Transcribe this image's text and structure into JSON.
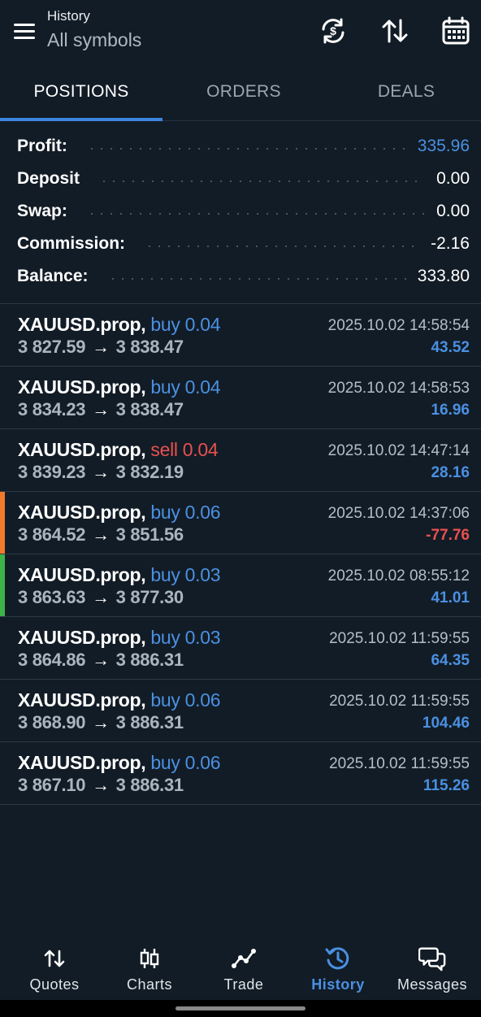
{
  "header": {
    "subtitle": "History",
    "title": "All symbols",
    "icons": [
      "menu-icon",
      "currency-exchange-icon",
      "sort-icon",
      "calendar-icon"
    ]
  },
  "tabs": [
    {
      "label": "POSITIONS",
      "active": true
    },
    {
      "label": "ORDERS",
      "active": false
    },
    {
      "label": "DEALS",
      "active": false
    }
  ],
  "summary": [
    {
      "label": "Profit:",
      "value": "335.96",
      "highlight": true
    },
    {
      "label": "Deposit",
      "value": "0.00",
      "highlight": false
    },
    {
      "label": "Swap:",
      "value": "0.00",
      "highlight": false
    },
    {
      "label": "Commission:",
      "value": "-2.16",
      "highlight": false
    },
    {
      "label": "Balance:",
      "value": "333.80",
      "highlight": false
    }
  ],
  "deals": [
    {
      "symbol": "XAUUSD.prop,",
      "side": "buy 0.04",
      "type": "buy",
      "open": "3 827.59",
      "close": "3 838.47",
      "time": "2025.10.02 14:58:54",
      "profit": "43.52",
      "sign": "pos",
      "marker": ""
    },
    {
      "symbol": "XAUUSD.prop,",
      "side": "buy 0.04",
      "type": "buy",
      "open": "3 834.23",
      "close": "3 838.47",
      "time": "2025.10.02 14:58:53",
      "profit": "16.96",
      "sign": "pos",
      "marker": ""
    },
    {
      "symbol": "XAUUSD.prop,",
      "side": "sell 0.04",
      "type": "sell",
      "open": "3 839.23",
      "close": "3 832.19",
      "time": "2025.10.02 14:47:14",
      "profit": "28.16",
      "sign": "pos",
      "marker": ""
    },
    {
      "symbol": "XAUUSD.prop,",
      "side": "buy 0.06",
      "type": "buy",
      "open": "3 864.52",
      "close": "3 851.56",
      "time": "2025.10.02 14:37:06",
      "profit": "-77.76",
      "sign": "neg",
      "marker": "#f07a2a"
    },
    {
      "symbol": "XAUUSD.prop,",
      "side": "buy 0.03",
      "type": "buy",
      "open": "3 863.63",
      "close": "3 877.30",
      "time": "2025.10.02 08:55:12",
      "profit": "41.01",
      "sign": "pos",
      "marker": "#3cb44a"
    },
    {
      "symbol": "XAUUSD.prop,",
      "side": "buy 0.03",
      "type": "buy",
      "open": "3 864.86",
      "close": "3 886.31",
      "time": "2025.10.02 11:59:55",
      "profit": "64.35",
      "sign": "pos",
      "marker": ""
    },
    {
      "symbol": "XAUUSD.prop,",
      "side": "buy 0.06",
      "type": "buy",
      "open": "3 868.90",
      "close": "3 886.31",
      "time": "2025.10.02 11:59:55",
      "profit": "104.46",
      "sign": "pos",
      "marker": ""
    },
    {
      "symbol": "XAUUSD.prop,",
      "side": "buy 0.06",
      "type": "buy",
      "open": "3 867.10",
      "close": "3 886.31",
      "time": "2025.10.02 11:59:55",
      "profit": "115.26",
      "sign": "pos",
      "marker": ""
    }
  ],
  "arrow": "→",
  "nav": [
    {
      "label": "Quotes",
      "icon": "quotes-icon",
      "active": false
    },
    {
      "label": "Charts",
      "icon": "charts-icon",
      "active": false
    },
    {
      "label": "Trade",
      "icon": "trade-icon",
      "active": false
    },
    {
      "label": "History",
      "icon": "history-icon",
      "active": true
    },
    {
      "label": "Messages",
      "icon": "messages-icon",
      "active": false
    }
  ],
  "colors": {
    "background": "#121c26",
    "accent": "#4a90e2",
    "negative": "#e85050"
  }
}
